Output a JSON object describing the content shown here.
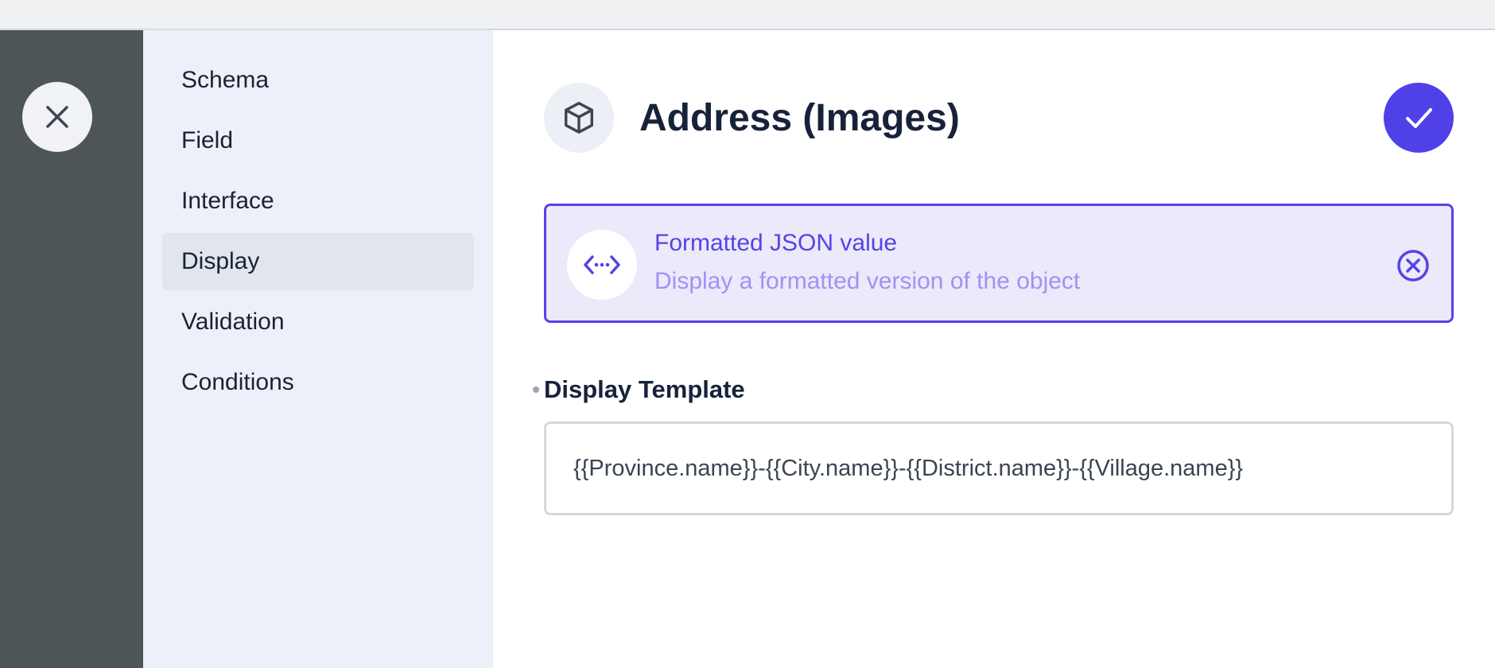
{
  "nav": {
    "items": [
      {
        "label": "Schema",
        "active": false
      },
      {
        "label": "Field",
        "active": false
      },
      {
        "label": "Interface",
        "active": false
      },
      {
        "label": "Display",
        "active": true
      },
      {
        "label": "Validation",
        "active": false
      },
      {
        "label": "Conditions",
        "active": false
      }
    ]
  },
  "header": {
    "title": "Address (Images)",
    "icon": "cube-icon",
    "confirm_icon": "check-icon"
  },
  "rail": {
    "close_icon": "close-icon"
  },
  "display": {
    "title": "Formatted JSON value",
    "description": "Display a formatted version of the object",
    "icon": "code-brackets-icon",
    "clear_icon": "clear-circle-icon"
  },
  "field": {
    "label": "Display Template",
    "value": "{{Province.name}}-{{City.name}}-{{District.name}}-{{Village.name}}"
  },
  "colors": {
    "accent": "#5444e6",
    "rail": "#4e5558",
    "nav_bg": "#edf0f8",
    "card_bg": "#ece9fb"
  }
}
